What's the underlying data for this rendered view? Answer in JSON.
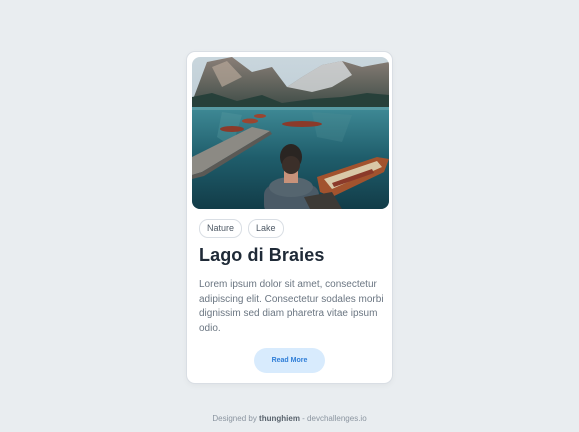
{
  "card": {
    "image_alt": "Man sitting on a dock by a mountain lake with rowing boats",
    "tags": [
      "Nature",
      "Lake"
    ],
    "title": "Lago di Braies",
    "description": "Lorem ipsum dolor sit amet, consectetur adipiscing elit. Consectetur sodales morbi dignissim sed diam pharetra vitae ipsum odio.",
    "button_label": "Read More"
  },
  "footer": {
    "prefix": "Designed by ",
    "author": "thunghiem",
    "suffix": " - devchallenges.io"
  },
  "colors": {
    "page_background": "#e9edf0",
    "card_background": "#ffffff",
    "button_background": "#d8ebfd",
    "button_text": "#2f7ed8",
    "title_text": "#1f2a37",
    "body_text": "#6b7682"
  }
}
